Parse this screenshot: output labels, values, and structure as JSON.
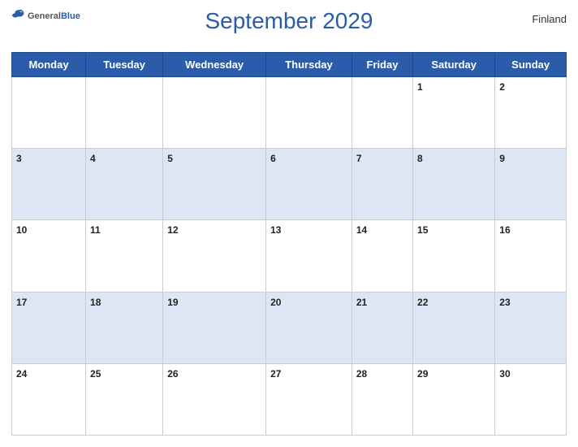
{
  "header": {
    "title": "September 2029",
    "country": "Finland",
    "logo": {
      "general": "General",
      "blue": "Blue"
    }
  },
  "weekdays": [
    "Monday",
    "Tuesday",
    "Wednesday",
    "Thursday",
    "Friday",
    "Saturday",
    "Sunday"
  ],
  "weeks": [
    [
      null,
      null,
      null,
      null,
      null,
      1,
      2
    ],
    [
      3,
      4,
      5,
      6,
      7,
      8,
      9
    ],
    [
      10,
      11,
      12,
      13,
      14,
      15,
      16
    ],
    [
      17,
      18,
      19,
      20,
      21,
      22,
      23
    ],
    [
      24,
      25,
      26,
      27,
      28,
      29,
      30
    ]
  ]
}
